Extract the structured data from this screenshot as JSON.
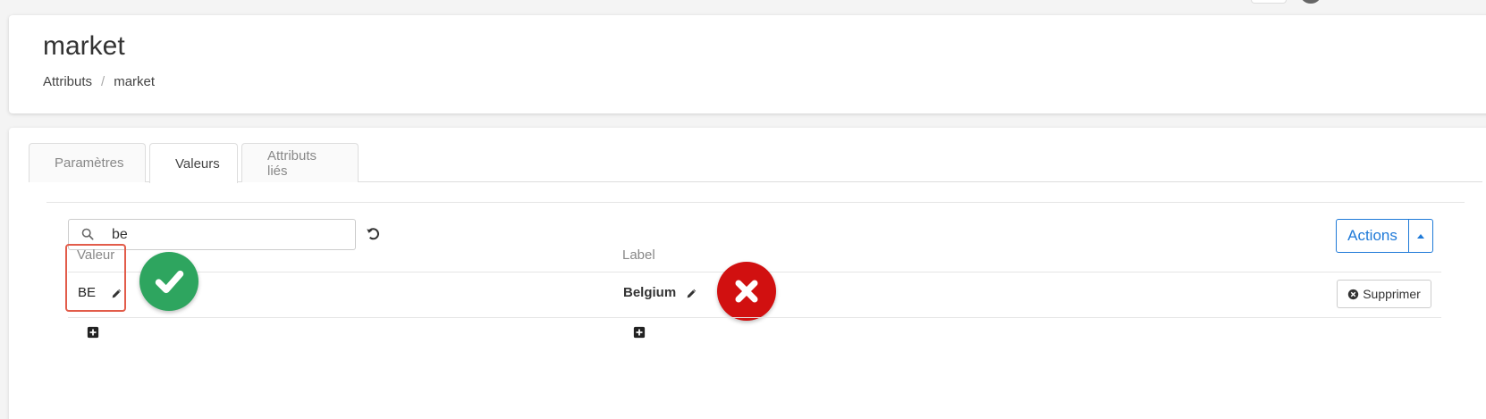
{
  "header": {
    "title": "market",
    "breadcrumb": [
      "Attributs",
      "market"
    ],
    "breadcrumb_sep": "/"
  },
  "tabs": [
    {
      "label": "Paramètres",
      "active": false
    },
    {
      "label": "Valeurs",
      "active": true
    },
    {
      "label": "Attributs liés",
      "active": false
    }
  ],
  "search": {
    "value": "be",
    "placeholder": ""
  },
  "actions": {
    "label": "Actions"
  },
  "table": {
    "columns": [
      "Valeur",
      "Label"
    ],
    "rows": [
      {
        "valeur": "BE",
        "label": "Belgium",
        "delete_label": "Supprimer"
      }
    ]
  },
  "colors": {
    "accent": "#1f7ad8",
    "check": "#2ea55f",
    "cross": "#d11010",
    "highlight": "#e25c4a"
  },
  "icons": [
    "search-icon",
    "reset-icon",
    "caret-up-icon",
    "pencil-icon",
    "check-icon",
    "cross-icon",
    "times-circle-icon",
    "plus-square-icon"
  ]
}
